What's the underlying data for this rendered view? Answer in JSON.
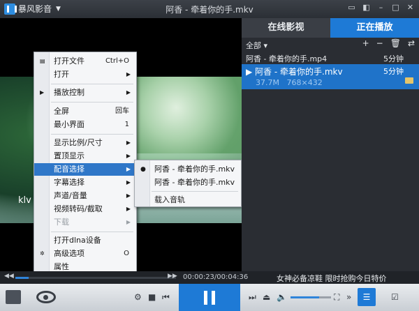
{
  "app": {
    "logo_label": "暴风影音",
    "window_title": "阿香 - 牵着你的手.mkv"
  },
  "video": {
    "subtitle_fragment": "klv"
  },
  "context_menu": {
    "items": [
      {
        "label": "打开文件",
        "shortcut": "Ctrl+O"
      },
      {
        "label": "打开",
        "arrow": "▶"
      },
      {
        "label": "播放控制",
        "arrow": "▶",
        "lead": "▶"
      },
      {
        "label": "全屏",
        "shortcut": "回车"
      },
      {
        "label": "最小界面",
        "shortcut": "1"
      },
      {
        "label": "显示比例/尺寸",
        "arrow": "▶"
      },
      {
        "label": "置顶显示",
        "arrow": "▶"
      },
      {
        "label": "配音选择",
        "arrow": "▶"
      },
      {
        "label": "字幕选择",
        "arrow": "▶"
      },
      {
        "label": "声道/音量",
        "arrow": "▶"
      },
      {
        "label": "视频转码/截取",
        "arrow": "▶"
      },
      {
        "label": "下载",
        "arrow": "▶"
      },
      {
        "label": "打开dlna设备"
      },
      {
        "label": "高级选项",
        "shortcut": "O"
      },
      {
        "label": "属性"
      }
    ]
  },
  "submenu": {
    "items": [
      {
        "label": "阿香 - 牵着你的手.mkv",
        "selected_mark": "●"
      },
      {
        "label": "阿香 - 牵着你的手.mkv"
      },
      {
        "label": "载入音轨"
      }
    ]
  },
  "panel": {
    "tabs": [
      {
        "label": "在线影视"
      },
      {
        "label": "正在播放"
      }
    ],
    "filter_label": "全部 ▾",
    "tool_icons": [
      "+",
      "−",
      "🗑",
      "⇄"
    ],
    "playlist": [
      {
        "name": "阿香 - 牵着你的手.mp4",
        "duration": "5分钟"
      },
      {
        "name": "▶ 阿香 - 牵着你的手.mkv",
        "duration": "5分钟",
        "size": "37.7M",
        "resolution": "768×432"
      }
    ]
  },
  "seekbar": {
    "timecode": "00:00:23/00:04:36",
    "progress": 0.083,
    "ad_text": "女神必备凉鞋 限时抢购今日特价"
  },
  "controls": {
    "volume": 0.7
  },
  "colors": {
    "accent": "#1e7ad6",
    "menu_highlight": "#2f77c8",
    "panel_bg": "#2a2d33"
  }
}
